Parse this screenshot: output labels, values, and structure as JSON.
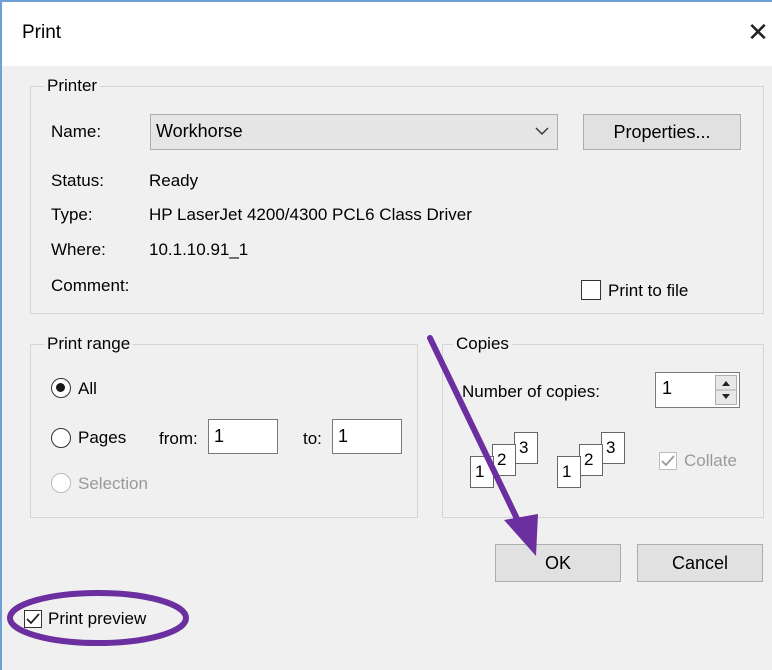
{
  "dialog": {
    "title": "Print"
  },
  "printer": {
    "group_label": "Printer",
    "name_label": "Name:",
    "name_value": "Workhorse",
    "properties_button": "Properties...",
    "status_label": "Status:",
    "status_value": "Ready",
    "type_label": "Type:",
    "type_value": "HP LaserJet 4200/4300 PCL6 Class Driver",
    "where_label": "Where:",
    "where_value": "10.1.10.91_1",
    "comment_label": "Comment:",
    "print_to_file_label": "Print to file",
    "print_to_file_checked": false
  },
  "print_range": {
    "group_label": "Print range",
    "all_label": "All",
    "all_selected": true,
    "pages_label": "Pages",
    "from_label": "from:",
    "from_value": "1",
    "to_label": "to:",
    "to_value": "1",
    "selection_label": "Selection"
  },
  "copies": {
    "group_label": "Copies",
    "number_label": "Number of copies:",
    "number_value": "1",
    "collate_label": "Collate",
    "collate_checked": true,
    "page_numbers": [
      "1",
      "2",
      "3"
    ]
  },
  "buttons": {
    "ok": "OK",
    "cancel": "Cancel"
  },
  "print_preview": {
    "label": "Print preview",
    "checked": true
  },
  "annotation_color": "#6b2fa0"
}
